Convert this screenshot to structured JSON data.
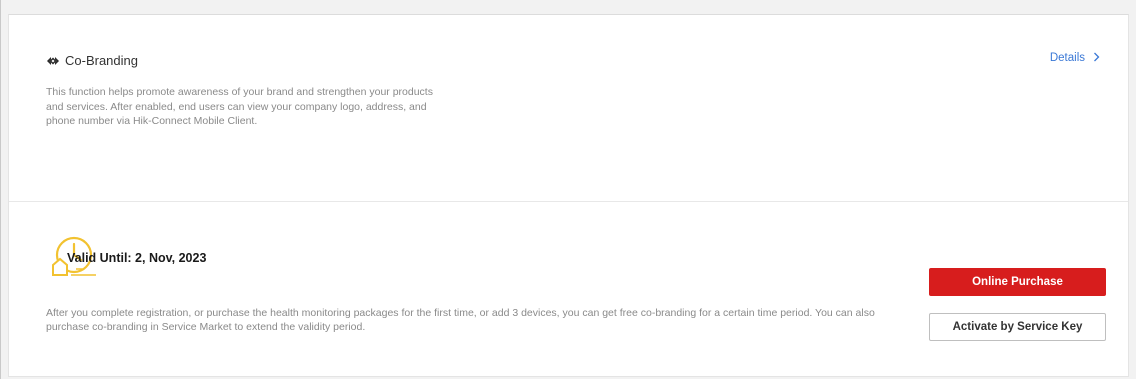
{
  "header": {
    "title": "Co-Branding",
    "title_icon": "co-branding-icon",
    "description": "This function helps promote awareness of your brand and strengthen your products and services. After enabled, end users can view your company logo, address, and phone number via Hik-Connect Mobile Client.",
    "details_label": "Details",
    "details_icon": "chevron-right-icon"
  },
  "validity": {
    "icon": "clock-house-icon",
    "valid_until": "Valid Until: 2, Nov, 2023",
    "info": "After you complete registration, or purchase the health monitoring packages for the first time, or add 3 devices, you can get free co-branding for a certain time period. You can also purchase co-branding in Service Market to extend the validity period."
  },
  "actions": {
    "online_purchase": "Online Purchase",
    "activate_key": "Activate by Service Key"
  },
  "colors": {
    "accent_red": "#d71d1d",
    "link_blue": "#3a78d6",
    "icon_yellow": "#f2c230"
  }
}
